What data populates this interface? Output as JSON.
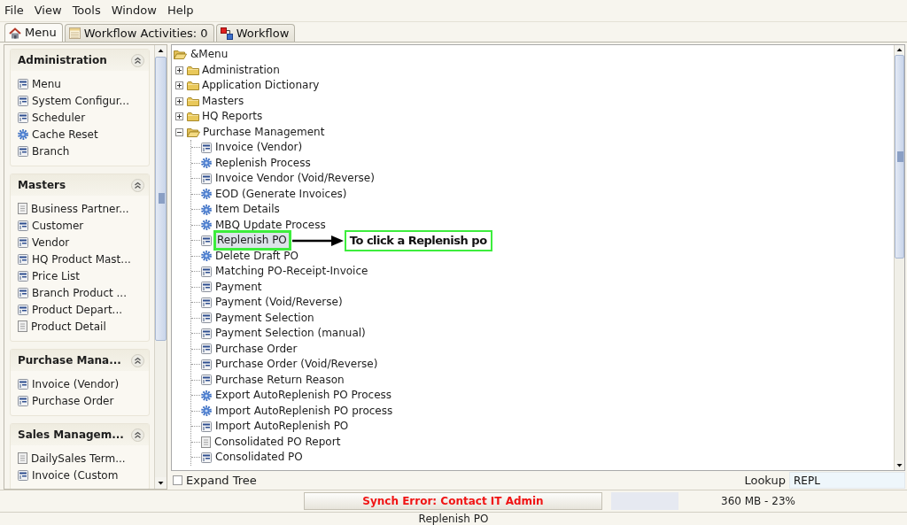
{
  "menu_bar": [
    {
      "label": "File"
    },
    {
      "label": "View"
    },
    {
      "label": "Tools"
    },
    {
      "label": "Window"
    },
    {
      "label": "Help"
    }
  ],
  "tabs": [
    {
      "label": "Menu",
      "kind": "home",
      "selected": true
    },
    {
      "label": "Workflow Activities: 0",
      "kind": "activities",
      "selected": false
    },
    {
      "label": "Workflow",
      "kind": "workflow",
      "selected": false
    }
  ],
  "sidebar": {
    "groups": [
      {
        "title": "Administration",
        "expanded": true,
        "items": [
          {
            "label": "Menu",
            "kind": "window"
          },
          {
            "label": "System Configur...",
            "kind": "window"
          },
          {
            "label": "Scheduler",
            "kind": "window"
          },
          {
            "label": "Cache Reset",
            "kind": "process"
          },
          {
            "label": "Branch",
            "kind": "window"
          }
        ]
      },
      {
        "title": "Masters",
        "expanded": true,
        "items": [
          {
            "label": "Business Partner...",
            "kind": "report"
          },
          {
            "label": "Customer",
            "kind": "window"
          },
          {
            "label": "Vendor",
            "kind": "window"
          },
          {
            "label": "HQ Product Mast...",
            "kind": "window"
          },
          {
            "label": "Price List",
            "kind": "window"
          },
          {
            "label": "Branch Product ...",
            "kind": "window"
          },
          {
            "label": "Product Depart...",
            "kind": "window"
          },
          {
            "label": "Product Detail",
            "kind": "report"
          }
        ]
      },
      {
        "title": "Purchase Mana...",
        "expanded": true,
        "items": [
          {
            "label": "Invoice (Vendor)",
            "kind": "window"
          },
          {
            "label": "Purchase Order",
            "kind": "window"
          }
        ]
      },
      {
        "title": "Sales Managem...",
        "expanded": true,
        "items": [
          {
            "label": "DailySales Term...",
            "kind": "report"
          },
          {
            "label": "Invoice (Custom",
            "kind": "window"
          }
        ]
      }
    ]
  },
  "tree": {
    "label": "&Menu",
    "kind": "folder",
    "expanded": true,
    "selected": false,
    "children": [
      {
        "label": "Administration",
        "kind": "folder",
        "expanded": false,
        "selected": false
      },
      {
        "label": "Application Dictionary",
        "kind": "folder",
        "expanded": false,
        "selected": false
      },
      {
        "label": "Masters",
        "kind": "folder",
        "expanded": false,
        "selected": false
      },
      {
        "label": "HQ Reports",
        "kind": "folder",
        "expanded": false,
        "selected": false
      },
      {
        "label": "Purchase Management",
        "kind": "folder",
        "expanded": true,
        "selected": false,
        "children": [
          {
            "label": "Invoice (Vendor)",
            "kind": "window",
            "selected": false
          },
          {
            "label": "Replenish Process",
            "kind": "process",
            "selected": false
          },
          {
            "label": "Invoice Vendor (Void/Reverse)",
            "kind": "window",
            "selected": false
          },
          {
            "label": "EOD (Generate Invoices)",
            "kind": "process",
            "selected": false
          },
          {
            "label": "Item Details",
            "kind": "process",
            "selected": false
          },
          {
            "label": "MBQ Update Process",
            "kind": "process",
            "selected": false
          },
          {
            "label": "Replenish PO",
            "kind": "window",
            "selected": true,
            "callout": "To click a Replenish po"
          },
          {
            "label": "Delete Draft PO",
            "kind": "process",
            "selected": false
          },
          {
            "label": "Matching PO-Receipt-Invoice",
            "kind": "window",
            "selected": false
          },
          {
            "label": "Payment",
            "kind": "window",
            "selected": false
          },
          {
            "label": "Payment (Void/Reverse)",
            "kind": "window",
            "selected": false
          },
          {
            "label": "Payment Selection",
            "kind": "window",
            "selected": false
          },
          {
            "label": "Payment Selection (manual)",
            "kind": "window",
            "selected": false
          },
          {
            "label": "Purchase Order",
            "kind": "window",
            "selected": false
          },
          {
            "label": "Purchase Order (Void/Reverse)",
            "kind": "window",
            "selected": false
          },
          {
            "label": "Purchase Return Reason",
            "kind": "window",
            "selected": false
          },
          {
            "label": "Export AutoReplenish PO Process",
            "kind": "process",
            "selected": false
          },
          {
            "label": "Import AutoReplenish PO process",
            "kind": "process",
            "selected": false
          },
          {
            "label": "Import AutoReplenish PO",
            "kind": "window",
            "selected": false
          },
          {
            "label": "Consolidated PO Report",
            "kind": "report",
            "selected": false
          },
          {
            "label": "Consolidated PO",
            "kind": "window",
            "selected": false
          }
        ]
      }
    ]
  },
  "expand_tree": {
    "label": "Expand Tree",
    "checked": false
  },
  "lookup": {
    "label": "Lookup",
    "value": "REPL"
  },
  "status_bar": {
    "sync_message": "Synch Error: Contact IT Admin",
    "memory": "360 MB - 23%",
    "message": "Replenish PO"
  }
}
